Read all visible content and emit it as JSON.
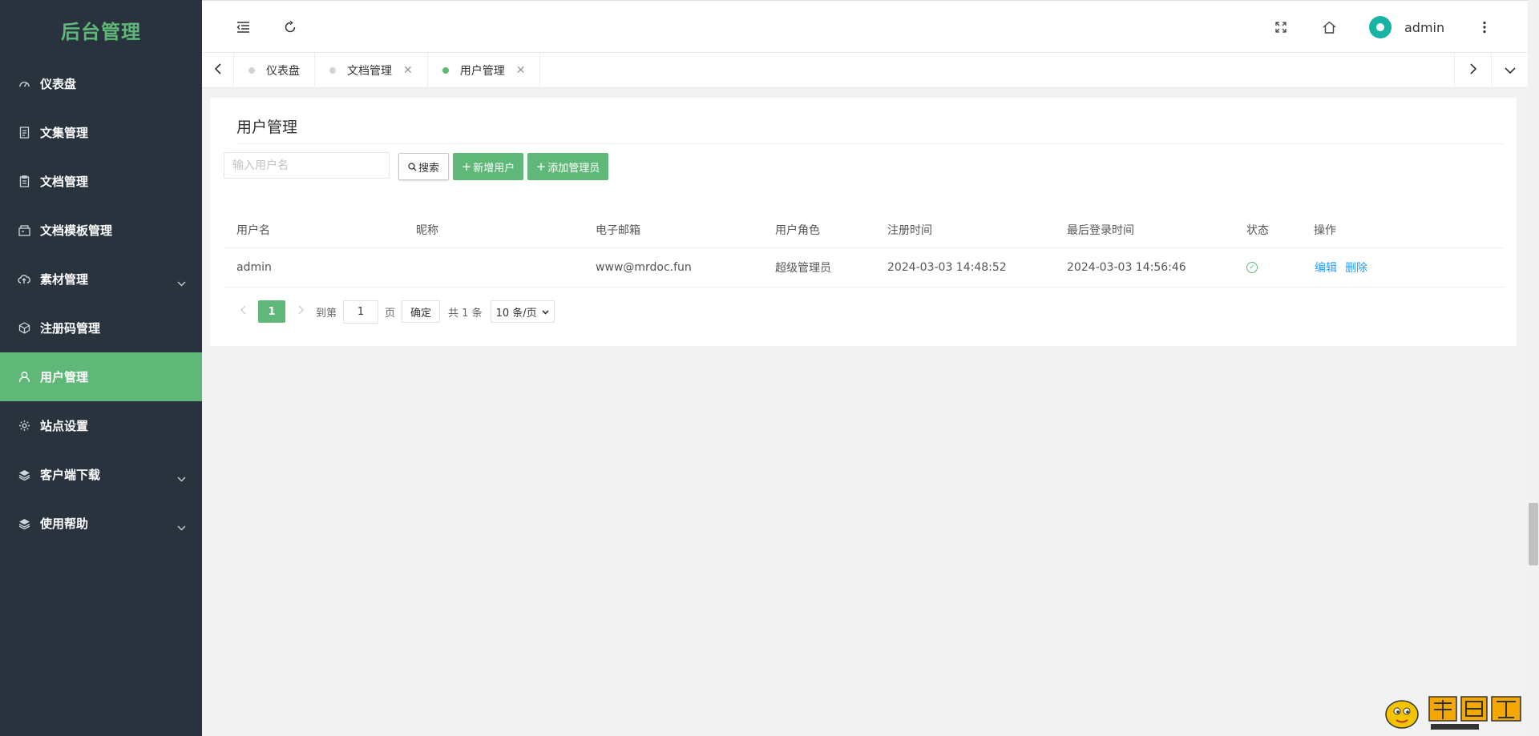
{
  "sidebar": {
    "logo": "后台管理",
    "items": [
      {
        "label": "仪表盘",
        "icon": "dashboard-icon"
      },
      {
        "label": "文集管理",
        "icon": "document-icon"
      },
      {
        "label": "文档管理",
        "icon": "file-icon"
      },
      {
        "label": "文档模板管理",
        "icon": "template-icon"
      },
      {
        "label": "素材管理",
        "icon": "cloud-icon",
        "expandable": true
      },
      {
        "label": "注册码管理",
        "icon": "cube-icon"
      },
      {
        "label": "用户管理",
        "icon": "user-icon",
        "active": true
      },
      {
        "label": "站点设置",
        "icon": "gear-icon"
      },
      {
        "label": "客户端下载",
        "icon": "layers-icon",
        "expandable": true
      },
      {
        "label": "使用帮助",
        "icon": "layers-icon",
        "expandable": true
      }
    ]
  },
  "header": {
    "username": "admin",
    "icons": [
      "menu-fold-icon",
      "refresh-icon",
      "fullscreen-icon",
      "home-icon",
      "more-vertical-icon"
    ]
  },
  "tabs": [
    {
      "label": "仪表盘",
      "closable": false,
      "active": false
    },
    {
      "label": "文档管理",
      "closable": true,
      "active": false
    },
    {
      "label": "用户管理",
      "closable": true,
      "active": true
    }
  ],
  "page": {
    "title": "用户管理",
    "search_placeholder": "输入用户名",
    "search_label": "搜索",
    "add_user_label": "新增用户",
    "add_admin_label": "添加管理员"
  },
  "table": {
    "columns": [
      "用户名",
      "昵称",
      "电子邮箱",
      "用户角色",
      "注册时间",
      "最后登录时间",
      "状态",
      "操作"
    ],
    "rows": [
      {
        "username": "admin",
        "nickname": "",
        "email": "www@mrdoc.fun",
        "role": "超级管理员",
        "registered": "2024-03-03 14:48:52",
        "last_login": "2024-03-03 14:56:46",
        "status": "enabled",
        "edit_label": "编辑",
        "delete_label": "删除"
      }
    ]
  },
  "pagination": {
    "current_page": "1",
    "goto_label": "到第",
    "goto_value": "1",
    "page_suffix": "页",
    "confirm_label": "确定",
    "total_label": "共 1 条",
    "page_size": "10 条/页"
  },
  "colors": {
    "sidebar_bg": "#28333e",
    "accent": "#5fb878",
    "link": "#1e9fff"
  }
}
